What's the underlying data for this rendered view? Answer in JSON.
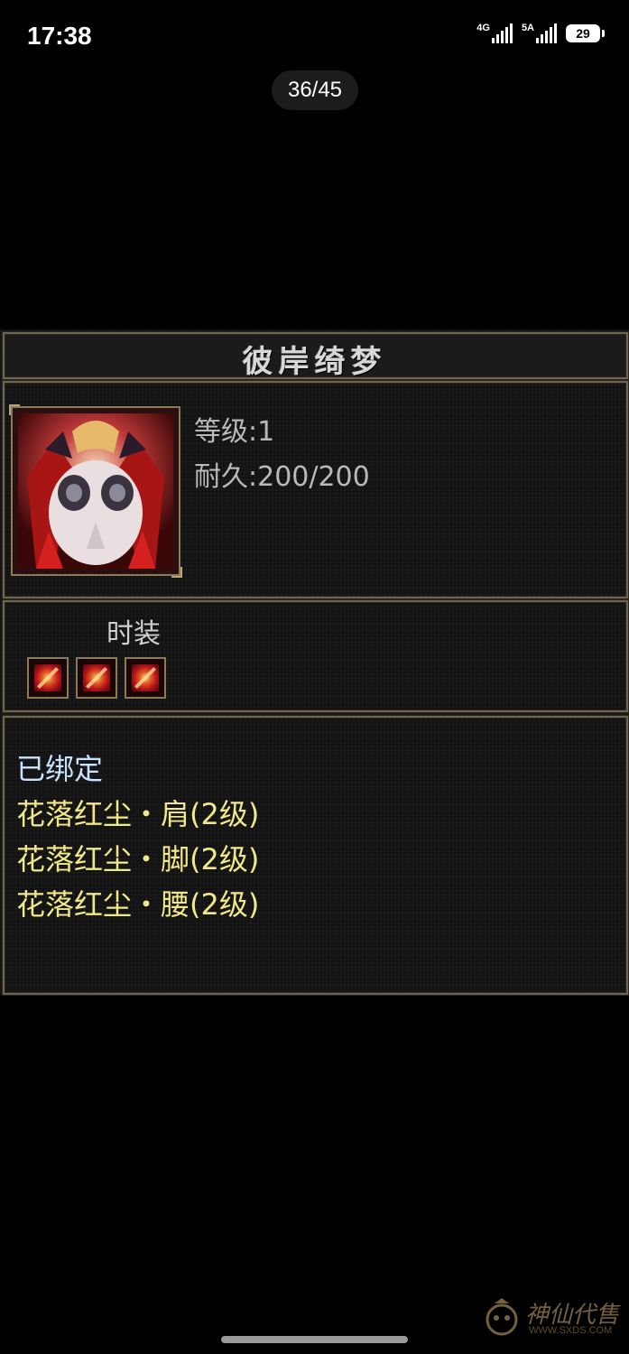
{
  "status_bar": {
    "time": "17:38",
    "network_1": "4G",
    "network_2": "5A",
    "battery": "29"
  },
  "viewer": {
    "page_counter": "36/45"
  },
  "item": {
    "name": "彼岸绮梦",
    "icon": "costume-portrait-icon",
    "level_line": "等级:1",
    "durability_line": "耐久:200/200",
    "type": "时装",
    "gem_slots": [
      "red-gem-icon",
      "red-gem-icon",
      "red-gem-icon"
    ],
    "bound_status": "已绑定",
    "set_items": [
      "花落红尘・肩(2级)",
      "花落红尘・脚(2级)",
      "花落红尘・腰(2级)"
    ]
  },
  "watermark": {
    "text": "神仙代售",
    "url": "WWW.SXDS.COM"
  },
  "colors": {
    "background": "#000000",
    "panel": "#141414",
    "frame": "#6e6452",
    "bound_text": "#c8e2ff",
    "set_text": "#f1e88a",
    "stat_text": "#b9b9b9"
  }
}
